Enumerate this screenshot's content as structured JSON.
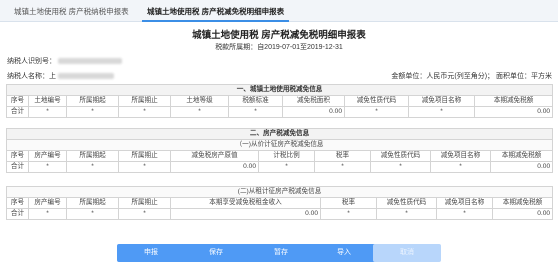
{
  "tabs": [
    {
      "label": "城镇土地使用税 房产税纳税申报表"
    },
    {
      "label": "城镇土地使用税 房产税减免税明细申报表"
    }
  ],
  "title": "城镇土地使用税 房产税减免税明细申报表",
  "period": {
    "label": "税款所属期：",
    "value": "自2019-07-01至2019-12-31"
  },
  "taxpayer_id": {
    "label": "纳税人识别号："
  },
  "taxpayer_name": {
    "label": "纳税人名称：上"
  },
  "units": "金额单位：人民币元(列至角分)； 面积单位：平方米",
  "land": {
    "section": "一、城镇土地使用税减免信息",
    "headers": [
      "序号",
      "土地编号",
      "所属期起",
      "所属期止",
      "土地等级",
      "税额标准",
      "减免税面积",
      "减免性质代码",
      "减免项目名称",
      "本期减免税额"
    ],
    "total": [
      "合计",
      "*",
      "*",
      "*",
      "*",
      "*",
      "0.00",
      "*",
      "*",
      "0.00"
    ]
  },
  "house": {
    "section": "二、房产税减免信息",
    "sub1": "（一)从价计征房产税减免信息",
    "headers1": [
      "序号",
      "房产编号",
      "所属期起",
      "所属期止",
      "减免税房产原值",
      "计税比例",
      "税率",
      "减免性质代码",
      "减免项目名称",
      "本期减免税额"
    ],
    "total1": [
      "合计",
      "*",
      "*",
      "*",
      "0.00",
      "*",
      "*",
      "*",
      "*",
      "0.00"
    ],
    "sub2": "(二)从租计征房产税减免信息",
    "headers2": [
      "序号",
      "房产编号",
      "所属期起",
      "所属期止",
      "本期享受减免税租金收入",
      "税率",
      "减免性质代码",
      "减免项目名称",
      "本期减免税额"
    ],
    "total2": [
      "合计",
      "*",
      "*",
      "*",
      "0.00",
      "*",
      "*",
      "*",
      "0.00"
    ]
  },
  "buttons": {
    "declare": "申报",
    "save": "保存",
    "temp_save": "暂存",
    "import": "导入",
    "cancel": "取消"
  }
}
